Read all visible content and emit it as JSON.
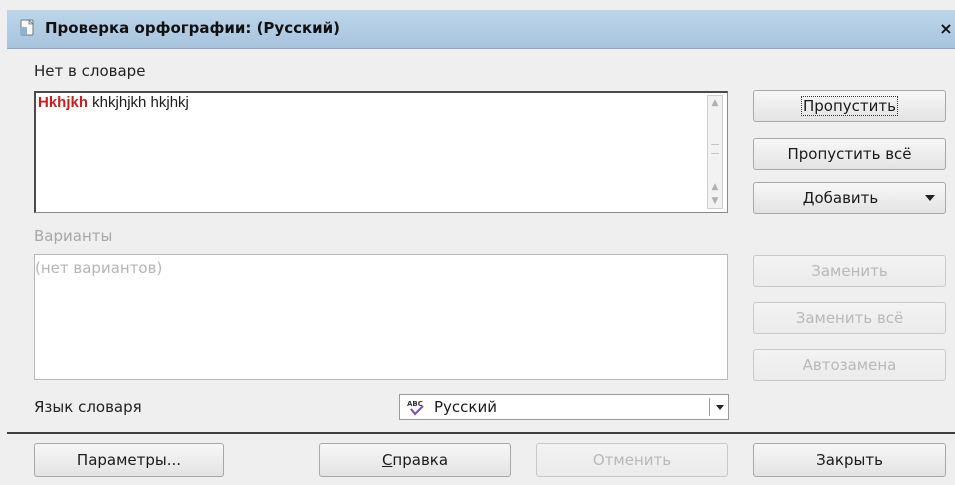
{
  "dialog": {
    "title": "Проверка орфографии:  (Русский)",
    "close_glyph": "×"
  },
  "not_in_dictionary": {
    "label": "Нет в словаре",
    "error_word": "Hkhjkh",
    "rest_text": " khkjhjkh hkjhkj"
  },
  "suggestions": {
    "label": "Варианты",
    "placeholder": "(нет вариантов)"
  },
  "side_buttons": {
    "ignore": "Пропустить",
    "ignore_all": "Пропустить всё",
    "add": "Добавить",
    "replace": "Заменить",
    "replace_all": "Заменить всё",
    "autocorrect": "Автозамена"
  },
  "language": {
    "label": "Язык словаря",
    "value": "Русский",
    "icon": "abc-spellcheck-icon"
  },
  "footer": {
    "options": "Параметры...",
    "help_prefix": "",
    "help_mnemonic": "С",
    "help_rest": "правка",
    "undo": "Отменить",
    "close": "Закрыть"
  },
  "colors": {
    "titlebar": "#a7c4dd",
    "error_word": "#d11a1a",
    "disabled_text": "#b8b8b8"
  }
}
